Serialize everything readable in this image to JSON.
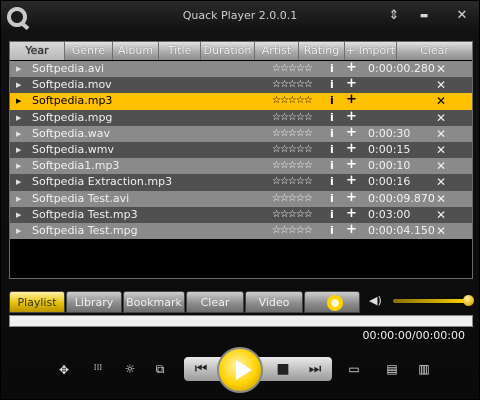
{
  "window": {
    "title": "Quack Player 2.0.0.1"
  },
  "titlebar": {
    "menu_glyph": "⇕",
    "minimize_glyph": "▬",
    "close_glyph": "✕"
  },
  "columns": [
    "Year",
    "Genre",
    "Album",
    "Title",
    "Duration",
    "Artist",
    "Rating",
    "+ Import",
    "Clear"
  ],
  "playlist": {
    "stars": "☆☆☆☆☆",
    "info_glyph": "i",
    "add_glyph": "+",
    "delete_glyph": "✕",
    "rows": [
      {
        "name": "Softpedia.avi",
        "duration": "0:00:00.280"
      },
      {
        "name": "Softpedia.mov",
        "duration": ""
      },
      {
        "name": "Softpedia.mp3",
        "duration": ""
      },
      {
        "name": "Softpedia.mpg",
        "duration": ""
      },
      {
        "name": "Softpedia.wav",
        "duration": "0:00:30"
      },
      {
        "name": "Softpedia.wmv",
        "duration": "0:00:15"
      },
      {
        "name": "Softpedia1.mp3",
        "duration": "0:00:10"
      },
      {
        "name": "Softpedia Extraction.mp3",
        "duration": "0:00:16"
      },
      {
        "name": "Softpedia Test.avi",
        "duration": "0:00:09.870"
      },
      {
        "name": "Softpedia Test.mp3",
        "duration": "0:03:00"
      },
      {
        "name": "Softpedia Test.mpg",
        "duration": "0:00:04.150"
      }
    ],
    "selected_index": 2
  },
  "tabs": [
    "Playlist",
    "Library",
    "Bookmark",
    "Clear",
    "Video"
  ],
  "active_tab": "Playlist",
  "volume": {
    "level": 1.0,
    "icon": "speaker-icon"
  },
  "time_display": "00:00:00/00:00:00",
  "controls": {
    "fullscreen_glyph": "✥",
    "playlist_glyph": "⁞⁞⁞",
    "brightness_glyph": "☼",
    "window_glyph": "⧉",
    "prev_glyph": "⏮",
    "stop_glyph": "■",
    "next_glyph": "⏭",
    "snapshot_glyph": "▭",
    "doc_glyph": "▤",
    "list_glyph": "▥"
  },
  "colors": {
    "accent": "#ffc000",
    "row_light": "#8a8a8a",
    "row_dark": "#505050"
  }
}
